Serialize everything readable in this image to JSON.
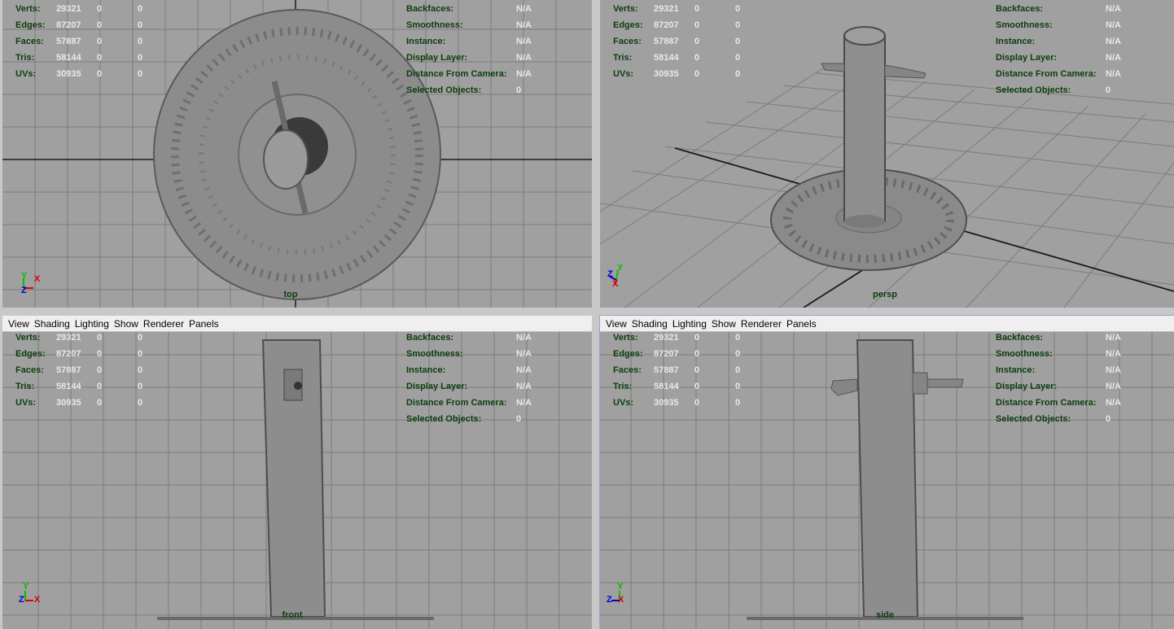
{
  "menu": [
    "View",
    "Shading",
    "Lighting",
    "Show",
    "Renderer",
    "Panels"
  ],
  "stats": [
    {
      "label": "Verts:",
      "v1": "29321",
      "v2": "0",
      "v3": "0"
    },
    {
      "label": "Edges:",
      "v1": "87207",
      "v2": "0",
      "v3": "0"
    },
    {
      "label": "Faces:",
      "v1": "57887",
      "v2": "0",
      "v3": "0"
    },
    {
      "label": "Tris:",
      "v1": "58144",
      "v2": "0",
      "v3": "0"
    },
    {
      "label": "UVs:",
      "v1": "30935",
      "v2": "0",
      "v3": "0"
    }
  ],
  "info": [
    {
      "label": "Backfaces:",
      "value": "N/A"
    },
    {
      "label": "Smoothness:",
      "value": "N/A"
    },
    {
      "label": "Instance:",
      "value": "N/A"
    },
    {
      "label": "Display Layer:",
      "value": "N/A"
    },
    {
      "label": "Distance From Camera:",
      "value": "N/A"
    },
    {
      "label": "Selected Objects:",
      "value": "0"
    }
  ],
  "viewports": [
    {
      "camera": "top",
      "axes": [
        "Y",
        "X",
        "Z"
      ]
    },
    {
      "camera": "persp",
      "axes": [
        "Y",
        "Z",
        "X"
      ]
    },
    {
      "camera": "front",
      "axes": [
        "Y",
        "Z",
        "X"
      ]
    },
    {
      "camera": "side",
      "axes": [
        "Y",
        "Z",
        "X"
      ]
    }
  ],
  "colors": {
    "viewport_bg": "#a0a0a0",
    "grid_line": "#7c7c7c",
    "axis_line": "#1a1a1a",
    "hud_label": "#0d3d0d",
    "hud_value": "#e8e8e8",
    "model": "#8a8a8a"
  }
}
